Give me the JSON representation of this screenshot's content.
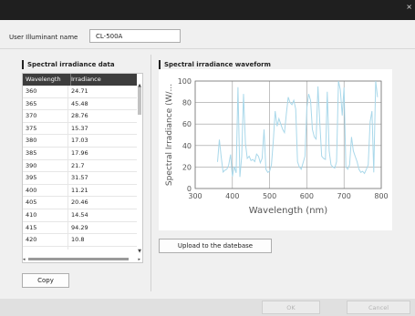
{
  "window": {
    "close_glyph": "×"
  },
  "illuminant": {
    "label": "User Illuminant name",
    "value": "CL-500A"
  },
  "data_panel": {
    "title": "Spectral irradiance data",
    "columns": [
      "Wavelength",
      "Irradiance"
    ],
    "rows": [
      [
        "360",
        "24.71"
      ],
      [
        "365",
        "45.48"
      ],
      [
        "370",
        "28.76"
      ],
      [
        "375",
        "15.37"
      ],
      [
        "380",
        "17.03"
      ],
      [
        "385",
        "17.96"
      ],
      [
        "390",
        "21.7"
      ],
      [
        "395",
        "31.57"
      ],
      [
        "400",
        "11.21"
      ],
      [
        "405",
        "20.46"
      ],
      [
        "410",
        "14.54"
      ],
      [
        "415",
        "94.29"
      ],
      [
        "420",
        "10.8"
      ]
    ],
    "copy_label": "Copy"
  },
  "waveform_panel": {
    "title": "Spectral irradiance waveform",
    "upload_label": "Upload to the datebase"
  },
  "chart_data": {
    "type": "line",
    "xlabel": "Wavelength (nm)",
    "ylabel": "Spectral Irradiance (W/...",
    "xlim": [
      300,
      800
    ],
    "ylim": [
      0,
      100
    ],
    "xticks": [
      300,
      400,
      500,
      600,
      700,
      800
    ],
    "yticks": [
      0,
      20,
      40,
      60,
      80,
      100
    ],
    "grid": true,
    "color": "#a9d8ea",
    "series": [
      {
        "x": [
          360,
          365,
          370,
          375,
          380,
          385,
          390,
          395,
          400,
          405,
          410,
          415,
          420,
          425,
          430,
          435,
          440,
          445,
          450,
          455,
          460,
          465,
          470,
          475,
          480,
          485,
          490,
          495,
          500,
          505,
          510,
          515,
          520,
          525,
          530,
          535,
          540,
          545,
          550,
          555,
          560,
          565,
          570,
          575,
          580,
          585,
          590,
          595,
          600,
          605,
          610,
          615,
          620,
          625,
          630,
          635,
          640,
          645,
          650,
          655,
          660,
          665,
          670,
          675,
          680,
          685,
          690,
          695,
          700,
          705,
          710,
          715,
          720,
          725,
          730,
          735,
          740,
          745,
          750,
          755,
          760,
          765,
          770,
          775,
          780,
          785,
          790
        ],
        "values": [
          24.71,
          45.48,
          28.76,
          15.37,
          17.03,
          17.96,
          21.7,
          31.57,
          11.21,
          20.46,
          14.54,
          94.29,
          10.8,
          30,
          88,
          42,
          28,
          30,
          26,
          27,
          25,
          32,
          30,
          24,
          28,
          55,
          18,
          15,
          16,
          22,
          45,
          72,
          58,
          65,
          60,
          55,
          52,
          70,
          85,
          80,
          78,
          82,
          74,
          25,
          20,
          18,
          24,
          30,
          75,
          88,
          82,
          55,
          48,
          46,
          95,
          60,
          30,
          28,
          27,
          90,
          35,
          22,
          20,
          19,
          25,
          100,
          92,
          68,
          94,
          20,
          18,
          22,
          48,
          35,
          30,
          25,
          18,
          15,
          16,
          14,
          18,
          22,
          62,
          72,
          15,
          100,
          85
        ]
      }
    ]
  },
  "footer": {
    "ok_label": "OK",
    "cancel_label": "Cancel"
  }
}
